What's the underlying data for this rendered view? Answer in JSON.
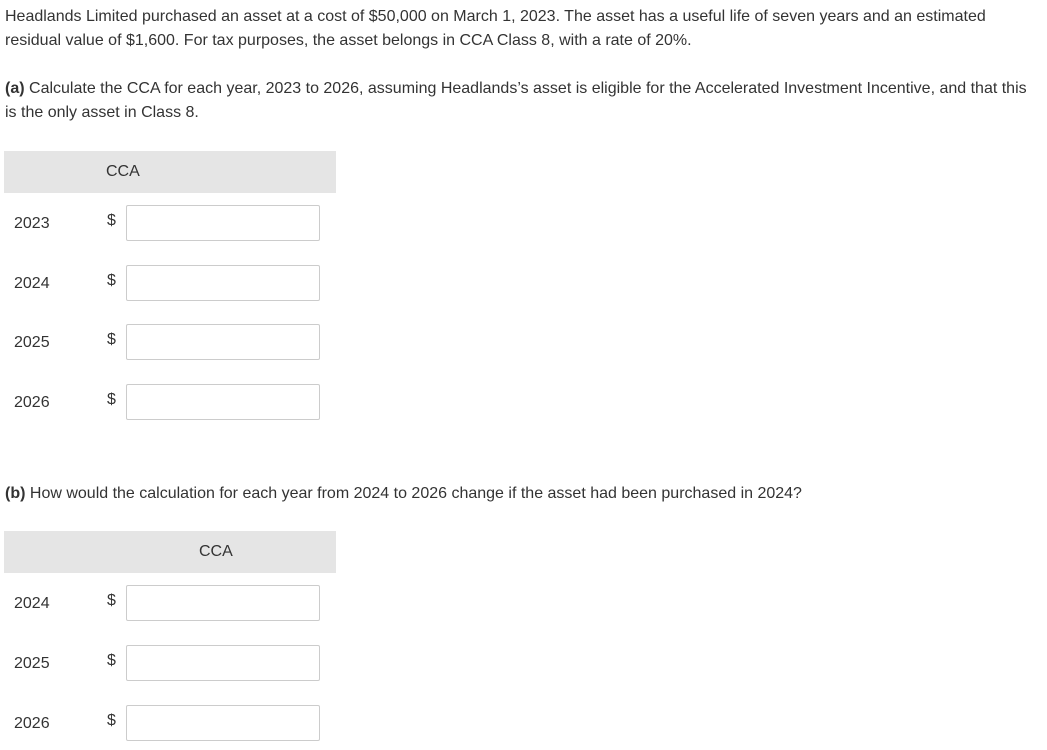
{
  "problem": {
    "intro": "Headlands Limited purchased an asset at a cost of $50,000 on March 1, 2023. The asset has a useful life of seven years and an estimated residual value of $1,600. For tax purposes, the asset belongs in CCA Class 8, with a rate of 20%."
  },
  "part_a": {
    "label": "(a)",
    "question": " Calculate the CCA for each year, 2023 to 2026, assuming Headlands’s asset is eligible for the Accelerated Investment Incentive, and that this is the only asset in Class 8.",
    "column_header": "CCA",
    "currency": "$",
    "rows": [
      {
        "year": "2023",
        "value": ""
      },
      {
        "year": "2024",
        "value": ""
      },
      {
        "year": "2025",
        "value": ""
      },
      {
        "year": "2026",
        "value": ""
      }
    ]
  },
  "part_b": {
    "label": "(b)",
    "question": " How would the calculation for each year from 2024 to 2026 change if the asset had been purchased in 2024?",
    "column_header": "CCA",
    "currency": "$",
    "rows": [
      {
        "year": "2024",
        "value": ""
      },
      {
        "year": "2025",
        "value": ""
      },
      {
        "year": "2026",
        "value": ""
      }
    ]
  }
}
